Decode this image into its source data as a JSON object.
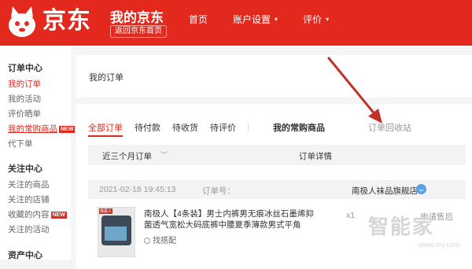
{
  "header": {
    "logo_text": "京东",
    "title": "我的京东",
    "home_link": "返回京东首页",
    "nav": [
      {
        "label": "首页",
        "caret": false
      },
      {
        "label": "账户设置",
        "caret": true
      },
      {
        "label": "评价",
        "caret": true
      }
    ],
    "caret_glyph": "▾"
  },
  "sidebar": {
    "groups": [
      {
        "title": "订单中心"
      },
      {
        "title": "关注中心"
      },
      {
        "title": "资产中心"
      }
    ],
    "items": [
      {
        "label": "我的订单"
      },
      {
        "label": "我的活动"
      },
      {
        "label": "评价晒单"
      },
      {
        "label": "我的常购商品",
        "badge": "NEW"
      },
      {
        "label": "代下单"
      },
      {
        "label": "关注的商品"
      },
      {
        "label": "关注的店铺"
      },
      {
        "label": "收藏的内容",
        "badge": "NEW"
      },
      {
        "label": "关注的活动"
      }
    ]
  },
  "main": {
    "title": "我的订单",
    "tabs": [
      "全部订单",
      "待付款",
      "待收货",
      "待评价"
    ],
    "tab_common": "我的常购商品",
    "tab_recycle": "订单回收站",
    "filter": {
      "range": "近三个月订单",
      "detail": "订单详情"
    },
    "order": {
      "date": "2021-02-18 19:45:13",
      "order_no_label": "订单号：",
      "shop": "南极人袜品旗舰店",
      "product_title": "南极人【4条装】男士内裤男无痕冰丝石墨烯抑菌透气宽松大码底裤中腰夏季薄款男式平角",
      "image_tag": "南极人",
      "match": "找搭配",
      "qty": "x1",
      "status": "申请售后"
    }
  },
  "watermark": {
    "text": "智能家",
    "url": "www.znj.com"
  },
  "colors": {
    "brand_red": "#e3281e",
    "arrow_red": "#c0312a"
  }
}
